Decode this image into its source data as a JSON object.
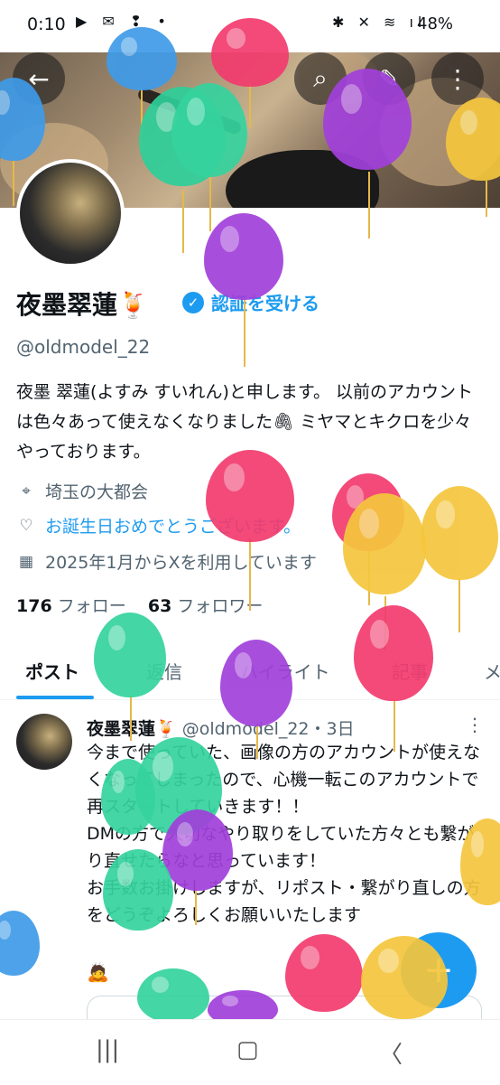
{
  "status_bar": {
    "time": "0:10",
    "left_icons": "▶ ✉ ❢ •",
    "right_icons": "✱ ✕ ≋ ıl",
    "battery": "48%"
  },
  "header": {
    "back_icon": "←",
    "search_icon": "⌕",
    "edit_icon": "✎",
    "more_icon": "⋮"
  },
  "profile": {
    "name": "夜墨翠蓮🍹",
    "verify_label": "認証を受ける",
    "handle": "@oldmodel_22",
    "bio": "夜墨 翠蓮(よすみ すいれん)と申します。 以前のアカウントは色々あって使えなくなりました🖇 ミヤマとキクロを少々やっております。",
    "location": "埼玉の大都会",
    "birthday": "お誕生日おめでとうございます。",
    "joined": "2025年1月からXを利用しています",
    "following_count": "176",
    "following_label": "フォロー",
    "followers_count": "63",
    "followers_label": "フォロワー"
  },
  "tabs": [
    "ポスト",
    "返信",
    "ハイライト",
    "記事",
    "メ"
  ],
  "post": {
    "author": "夜墨翠蓮🍹",
    "handle_time": "@oldmodel_22・3日",
    "body": "今まで使っていた、画像の方のアカウントが使えなくなってしまったので、心機一転このアカウントで再スタートしていきます！！\nDMの方で大切なやり取りをしていた方々とも繋がり直せたらなと思っています！\nお手数お掛けしますが、リポスト・繋がり直しの方をどうぞよろしくお願いいたします",
    "emoji": "🙇"
  },
  "fab_label": "+",
  "nav": {
    "recent": "|||",
    "home": "▢",
    "back": "〈"
  },
  "colors": {
    "accent": "#1d9bf0",
    "text": "#0f1419",
    "muted": "#536471"
  }
}
